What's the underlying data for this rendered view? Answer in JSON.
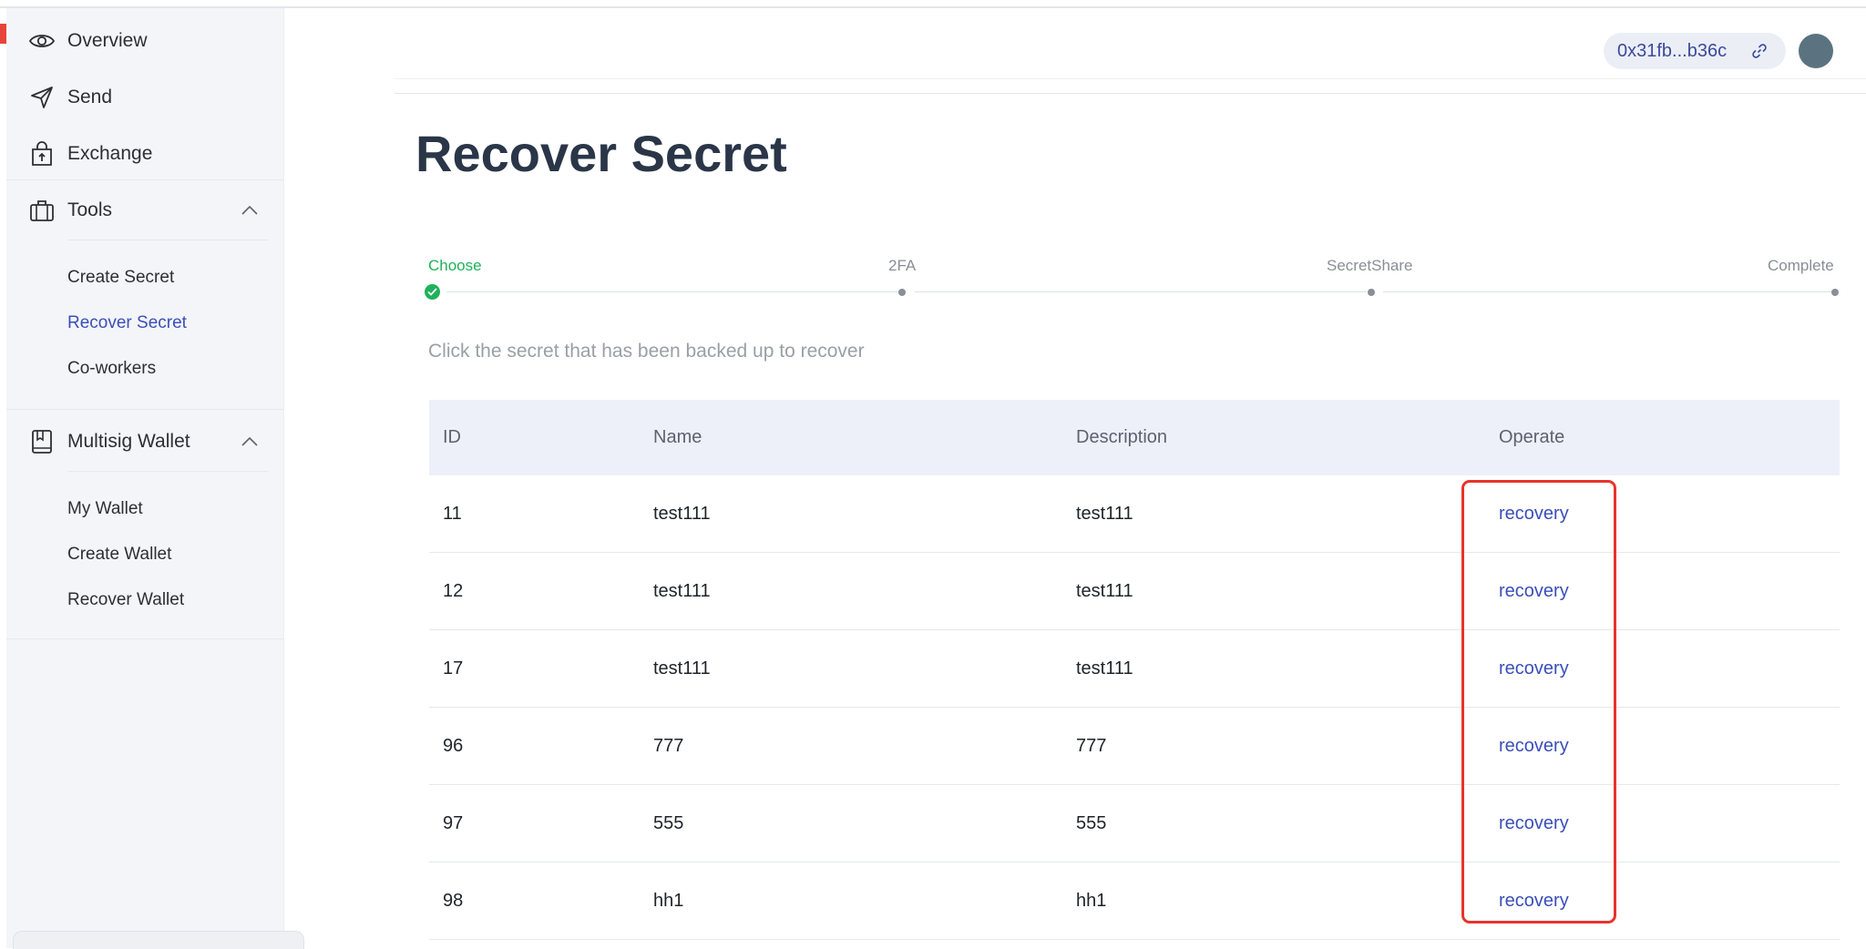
{
  "sidebar": {
    "items": [
      {
        "label": "Overview",
        "icon": "eye-icon"
      },
      {
        "label": "Send",
        "icon": "send-icon"
      },
      {
        "label": "Exchange",
        "icon": "shopping-bag-icon"
      }
    ],
    "tools": {
      "label": "Tools",
      "icon": "toolbox-icon",
      "expanded": true,
      "children": [
        "Create Secret",
        "Recover Secret",
        "Co-workers"
      ],
      "active": "Recover Secret"
    },
    "multisig": {
      "label": "Multisig Wallet",
      "icon": "book-icon",
      "expanded": true,
      "children": [
        "My Wallet",
        "Create Wallet",
        "Recover Wallet"
      ]
    }
  },
  "header": {
    "address": "0x31fb...b36c",
    "address_icon": "link-icon"
  },
  "page": {
    "title": "Recover Secret",
    "steps": [
      {
        "label": "Choose",
        "status": "done"
      },
      {
        "label": "2FA",
        "status": "pending"
      },
      {
        "label": "SecretShare",
        "status": "pending"
      },
      {
        "label": "Complete",
        "status": "pending"
      }
    ],
    "hint": "Click the secret that has been backed up to recover"
  },
  "table": {
    "columns": [
      "ID",
      "Name",
      "Description",
      "Operate"
    ],
    "rows": [
      {
        "id": "11",
        "name": "test111",
        "description": "test111",
        "operate": "recovery"
      },
      {
        "id": "12",
        "name": "test111",
        "description": "test111",
        "operate": "recovery"
      },
      {
        "id": "17",
        "name": "test111",
        "description": "test111",
        "operate": "recovery"
      },
      {
        "id": "96",
        "name": "777",
        "description": "777",
        "operate": "recovery"
      },
      {
        "id": "97",
        "name": "555",
        "description": "555",
        "operate": "recovery"
      },
      {
        "id": "98",
        "name": "hh1",
        "description": "hh1",
        "operate": "recovery"
      }
    ]
  },
  "colors": {
    "accent": "#3a4fb8",
    "success": "#1fb25a",
    "highlight": "#e8332a",
    "sidebar_bg": "#f4f5f8",
    "table_header_bg": "#edf0f8"
  }
}
